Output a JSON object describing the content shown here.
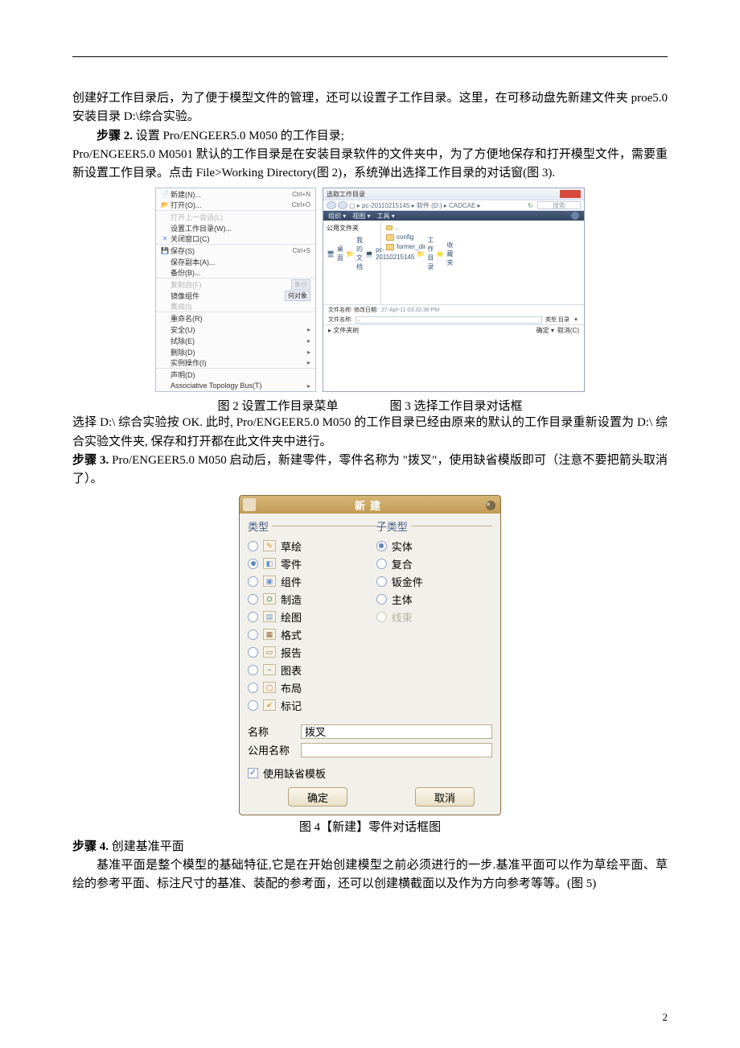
{
  "intro": {
    "p1": "创建好工作目录后，为了便于模型文件的管理，还可以设置子工作目录。这里，在可移动盘先新建文件夹 proe5.0 安装目录 D:\\综合实验。",
    "step2_prefix": "步骤 2.",
    "step2_rest": "设置 Pro/ENGEER5.0 M050 的工作目录;",
    "p2": "Pro/ENGEER5.0 M0501 默认的工作目录是在安装目录软件的文件夹中，为了方便地保存和打开模型文件，需要重新设置工作目录。点击 File>Working Directory(图 2)，系统弹出选择工作目录的对话窗(图 3).",
    "cap2": "图 2 设置工作目录菜单",
    "cap3": "图 3 选择工作目录对话框",
    "after23": "选择 D:\\ 综合实验按 OK. 此时, Pro/ENGEER5.0 M050 的工作目录已经由原来的默认的工作目录重新设置为 D:\\ 综合实验文件夹, 保存和打开都在此文件夹中进行。",
    "step3_prefix": "步骤 3.",
    "step3_rest": "Pro/ENGEER5.0 M050 启动后，新建零件，零件名称为 \"拨叉\"，使用缺省模版即可（注意不要把箭头取消了）。",
    "cap4": "图 4【新建】零件对话框图",
    "step4_prefix": "步骤 4.",
    "step4_rest": "创建基准平面",
    "p4": "基准平面是整个模型的基础特征,它是在开始创建模型之前必须进行的一步.基准平面可以作为草绘平面、草绘的参考平面、标注尺寸的基准、装配的参考面，还可以创建横截面以及作为方向参考等等。(图 5)"
  },
  "menu": {
    "items": [
      {
        "icon": "📄",
        "label": "新建(N)...",
        "sc": "Ctrl+N"
      },
      {
        "icon": "📂",
        "label": "打开(O)...",
        "sc": "Ctrl+O",
        "sep": true
      },
      {
        "icon": "",
        "label": "打开上一会话(L)",
        "dis": true
      },
      {
        "icon": "",
        "label": "设置工作目录(W)..."
      },
      {
        "icon": "✕",
        "label": "关闭窗口(C)",
        "sep": true,
        "icoCls": "bl"
      },
      {
        "icon": "💾",
        "label": "保存(S)",
        "sc": "Ctrl+S",
        "icoCls": "bl"
      },
      {
        "icon": "",
        "label": "保存副本(A)..."
      },
      {
        "icon": "",
        "label": "备份(B)...",
        "sep": true
      },
      {
        "icon": "",
        "label": "复制自(F)",
        "dis": true,
        "chip": "备份"
      },
      {
        "icon": "",
        "label": "镜像组件",
        "chip": "何对象"
      },
      {
        "icon": "",
        "label": "集成(I)",
        "dis": true,
        "sep": true
      },
      {
        "icon": "",
        "label": "重命名(R)"
      },
      {
        "icon": "",
        "label": "安全(U)",
        "arr": "▸"
      },
      {
        "icon": "",
        "label": "拭除(E)",
        "arr": "▸"
      },
      {
        "icon": "",
        "label": "删除(D)",
        "arr": "▸"
      },
      {
        "icon": "",
        "label": "实例操作(I)",
        "arr": "▸",
        "sep": true
      },
      {
        "icon": "",
        "label": "声明(D)"
      },
      {
        "icon": "",
        "label": "Associative Topology Bus(T)",
        "arr": "▸"
      }
    ]
  },
  "fb": {
    "title": "选取工作目录",
    "path": "▢ ▸ pc-20110215145 ▸ 软件 (D:) ▸ CADCAE ▸",
    "search_refresh": "↻",
    "search_ph": "搜索",
    "toolbar": [
      "组织 ▾",
      "视图 ▾",
      "工具 ▾"
    ],
    "side_hdr": "公用文件夹",
    "side": [
      "桌面",
      "我的文档",
      "pc-20110215145",
      "工作目录",
      "收藏夹"
    ],
    "side_ico": [
      "🖥",
      "📁",
      "💻",
      "📁",
      "⭐"
    ],
    "files": [
      "config",
      "former_dir"
    ],
    "f_datelbl": "文件名称:   修改日期:",
    "f_date": "27-Apr-11 03:32:36 PM",
    "f_name_lbl": "文件名称:",
    "f_name_val": ".",
    "f_type": "类型  目录",
    "tree": "▸ 文件夹树",
    "ok": "确定  ▾",
    "cancel": "取消(C)"
  },
  "dlg": {
    "title": "新建",
    "type_legend": "类型",
    "sub_legend": "子类型",
    "types": [
      "草绘",
      "零件",
      "组件",
      "制造",
      "绘图",
      "格式",
      "报告",
      "图表",
      "布局",
      "标记"
    ],
    "type_sel": 1,
    "subs": [
      "实体",
      "复合",
      "钣金件",
      "主体",
      "线束"
    ],
    "sub_sel": 0,
    "sub_dis": [
      4
    ],
    "name_lbl": "名称",
    "name_val": "拨叉",
    "common_lbl": "公用名称",
    "common_val": "",
    "chk_lbl": "使用缺省模板",
    "ok": "确定",
    "cancel": "取消"
  },
  "page_num": "2"
}
